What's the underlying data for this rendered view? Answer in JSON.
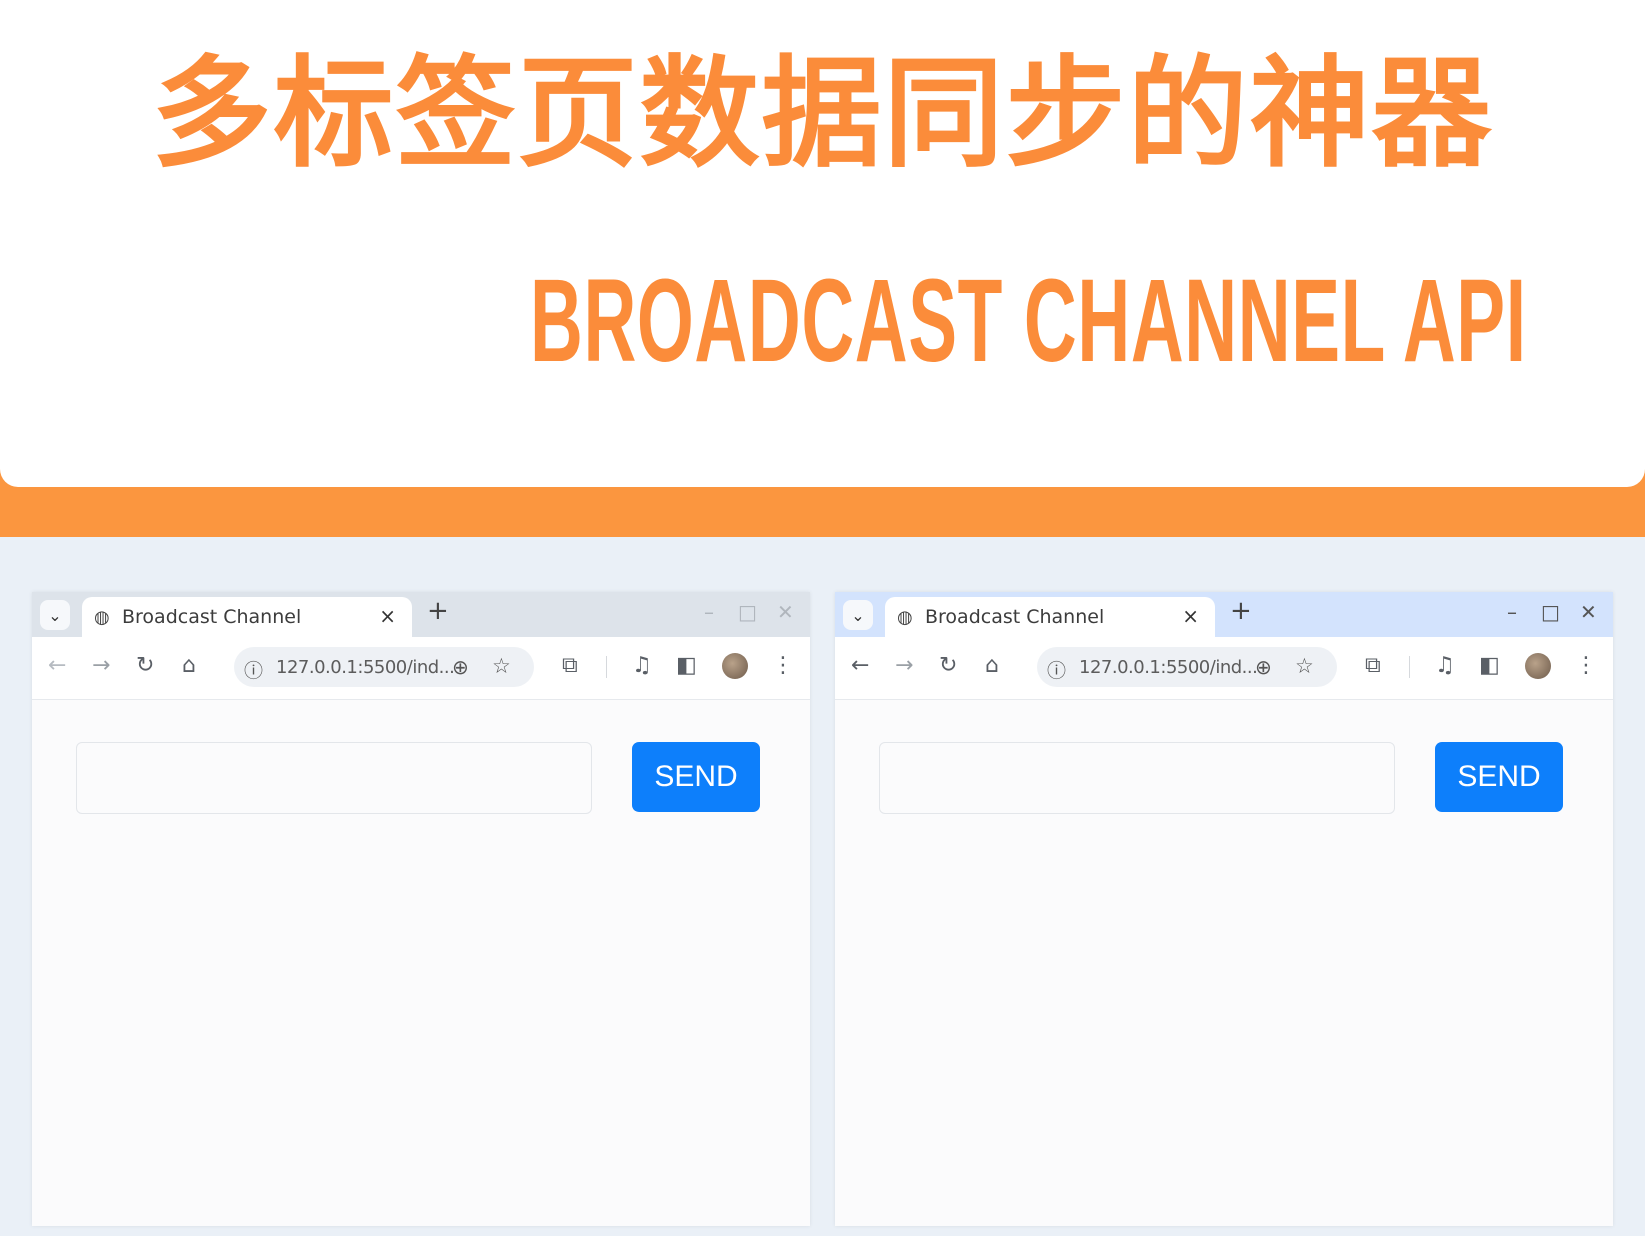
{
  "header": {
    "title_cn": "多标签页数据同步的神器",
    "title_en": "BROADCAST CHANNEL API"
  },
  "browsers": [
    {
      "tab_title": "Broadcast Channel",
      "url": "127.0.0.1:5500/ind...",
      "send_label": "SEND",
      "input_value": ""
    },
    {
      "tab_title": "Broadcast Channel",
      "url": "127.0.0.1:5500/ind...",
      "send_label": "SEND",
      "input_value": ""
    }
  ],
  "icons": {
    "tab_dropdown": "⌄",
    "close": "×",
    "new_tab": "+",
    "minimize": "–",
    "maximize": "□",
    "window_close": "✕",
    "back": "←",
    "forward": "→",
    "reload": "↻",
    "home": "⌂",
    "info": "ⓘ",
    "zoom": "⊕",
    "star": "☆",
    "extensions": "⧉",
    "media": "♫",
    "side_panel": "◧",
    "menu": "⋮",
    "globe": "◍"
  },
  "colors": {
    "accent_orange": "#fb8c3a",
    "send_blue": "#0d7ffb"
  }
}
